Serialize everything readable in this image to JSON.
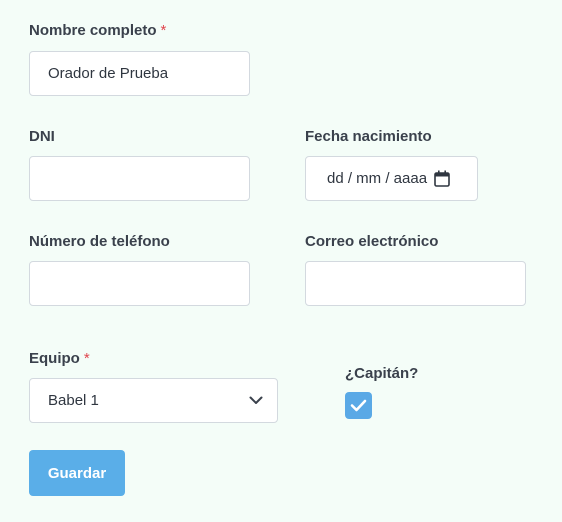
{
  "form": {
    "full_name": {
      "label": "Nombre completo",
      "required_mark": "*",
      "value": "Orador de Prueba"
    },
    "dni": {
      "label": "DNI",
      "value": ""
    },
    "birth_date": {
      "label": "Fecha nacimiento",
      "placeholder": "dd / mm / aaaa",
      "icon": "calendar-icon"
    },
    "phone": {
      "label": "Número de teléfono",
      "value": ""
    },
    "email": {
      "label": "Correo electrónico",
      "value": ""
    },
    "team": {
      "label": "Equipo",
      "required_mark": "*",
      "selected": "Babel 1",
      "icon": "chevron-down-icon"
    },
    "captain": {
      "label": "¿Capitán?",
      "checked": true,
      "icon": "checkmark-icon"
    },
    "save_button": {
      "label": "Guardar"
    }
  },
  "colors": {
    "background": "#f4fdf8",
    "required": "#e0464e",
    "accent": "#5aa9e6",
    "button": "#5aaee8"
  }
}
